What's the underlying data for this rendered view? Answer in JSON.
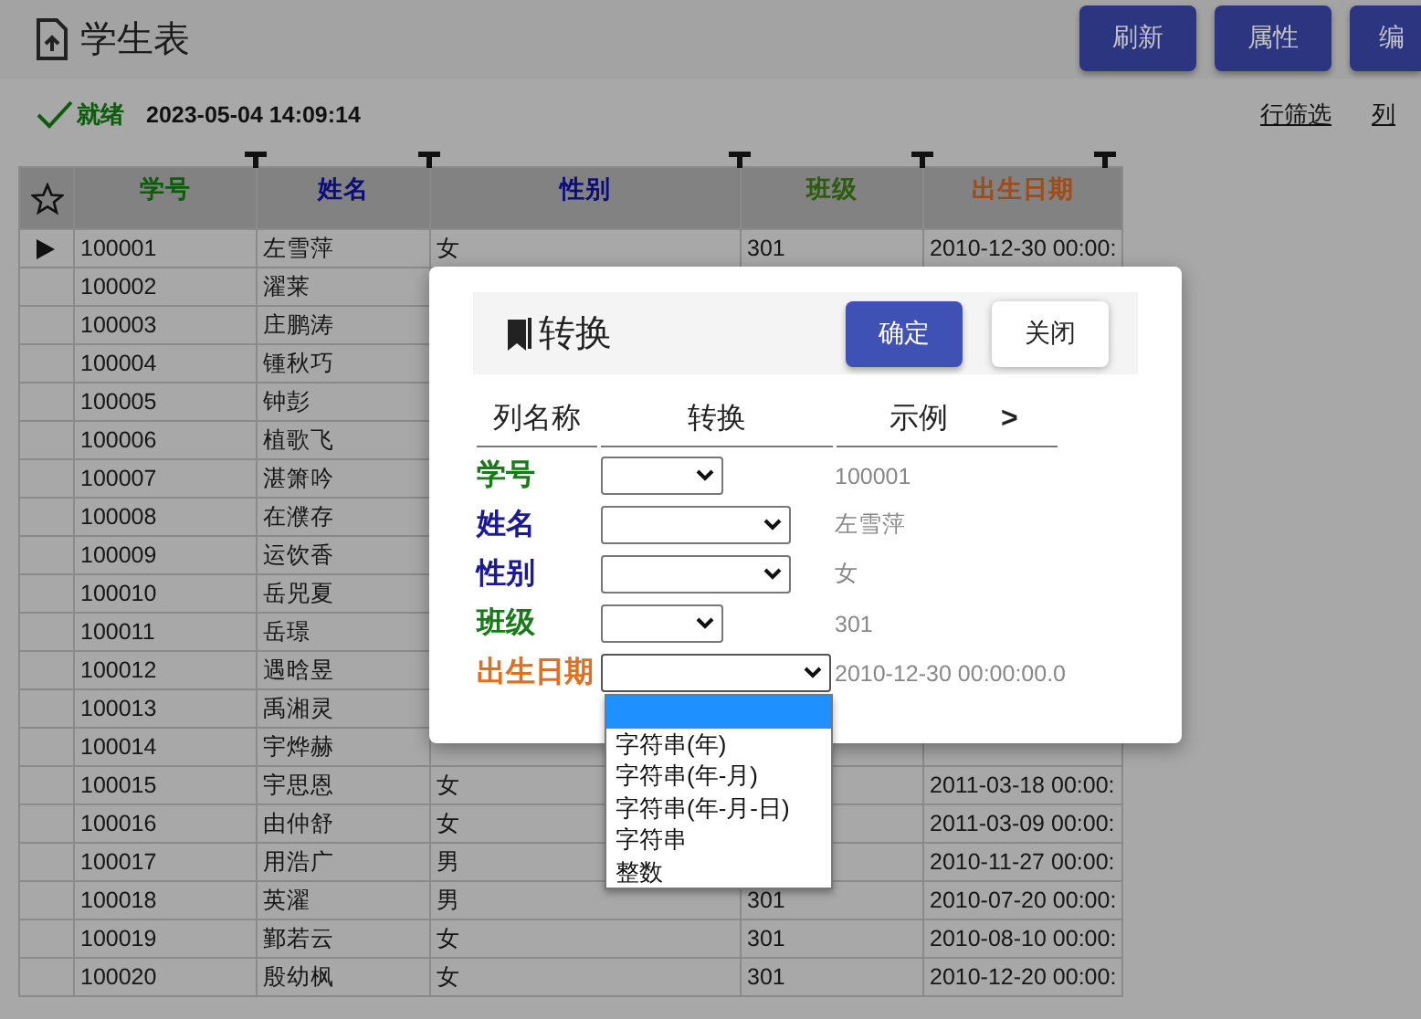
{
  "header": {
    "title": "学生表",
    "buttons": [
      "刷新",
      "属性",
      "编"
    ]
  },
  "status": {
    "label": "就绪",
    "time": "2023-05-04 14:09:14"
  },
  "links": [
    "行筛选",
    "列"
  ],
  "table": {
    "columns": [
      {
        "label": "学号",
        "color": "#0d5c0d"
      },
      {
        "label": "姓名",
        "color": "#0d0d7a"
      },
      {
        "label": "性别",
        "color": "#0d0d7a"
      },
      {
        "label": "班级",
        "color": "#2c5c0d"
      },
      {
        "label": "出生日期",
        "color": "#a04c1a"
      }
    ],
    "rows": [
      {
        "current": true,
        "cells": [
          "100001",
          "左雪萍",
          "女",
          "301",
          "2010-12-30 00:00:"
        ]
      },
      {
        "current": false,
        "cells": [
          "100002",
          "濯莱",
          null,
          null,
          null
        ]
      },
      {
        "current": false,
        "cells": [
          "100003",
          "庄鹏涛",
          null,
          null,
          null
        ]
      },
      {
        "current": false,
        "cells": [
          "100004",
          "锺秋巧",
          null,
          null,
          null
        ]
      },
      {
        "current": false,
        "cells": [
          "100005",
          "钟彭",
          null,
          null,
          null
        ]
      },
      {
        "current": false,
        "cells": [
          "100006",
          "植歌飞",
          null,
          null,
          null
        ]
      },
      {
        "current": false,
        "cells": [
          "100007",
          "湛箫吟",
          null,
          null,
          null
        ]
      },
      {
        "current": false,
        "cells": [
          "100008",
          "在濮存",
          null,
          null,
          null
        ]
      },
      {
        "current": false,
        "cells": [
          "100009",
          "运饮香",
          null,
          null,
          null
        ]
      },
      {
        "current": false,
        "cells": [
          "100010",
          "岳兕夏",
          null,
          null,
          null
        ]
      },
      {
        "current": false,
        "cells": [
          "100011",
          "岳璟",
          null,
          null,
          null
        ]
      },
      {
        "current": false,
        "cells": [
          "100012",
          "遇晗昱",
          null,
          null,
          null
        ]
      },
      {
        "current": false,
        "cells": [
          "100013",
          "禹湘灵",
          null,
          null,
          null
        ]
      },
      {
        "current": false,
        "cells": [
          "100014",
          "宇烨赫",
          null,
          null,
          null
        ]
      },
      {
        "current": false,
        "cells": [
          "100015",
          "宇思恩",
          "女",
          null,
          "2011-03-18 00:00:"
        ]
      },
      {
        "current": false,
        "cells": [
          "100016",
          "由仲舒",
          "女",
          null,
          "2011-03-09 00:00:"
        ]
      },
      {
        "current": false,
        "cells": [
          "100017",
          "用浩广",
          "男",
          null,
          "2010-11-27 00:00:"
        ]
      },
      {
        "current": false,
        "cells": [
          "100018",
          "英濯",
          "男",
          "301",
          "2010-07-20 00:00:"
        ]
      },
      {
        "current": false,
        "cells": [
          "100019",
          "鄞若云",
          "女",
          "301",
          "2010-08-10 00:00:"
        ]
      },
      {
        "current": false,
        "cells": [
          "100020",
          "殷幼枫",
          "女",
          "301",
          "2010-12-20 00:00:"
        ]
      }
    ]
  },
  "dialog": {
    "title": "转换",
    "buttons": [
      {
        "label": "确定",
        "kind": "primary"
      },
      {
        "label": "关闭",
        "kind": "plain"
      }
    ],
    "columns": [
      "列名称",
      "转换",
      "示例"
    ],
    "more": ">",
    "rows": [
      {
        "label": "学号",
        "color": "#1a7a1a",
        "example": "100001",
        "expanded": false
      },
      {
        "label": "姓名",
        "color": "#1a1a99",
        "example": "左雪萍",
        "expanded": false
      },
      {
        "label": "性别",
        "color": "#1a1a99",
        "example": "女",
        "expanded": false
      },
      {
        "label": "班级",
        "color": "#1a7a1a",
        "example": "301",
        "expanded": false
      },
      {
        "label": "出生日期",
        "color": "#e07020",
        "example": "2010-12-30 00:00:00.0",
        "expanded": true,
        "options": [
          {
            "selected": true
          },
          {
            "label": "字符串(年)",
            "selected": false
          },
          {
            "label": "字符串(年-月)",
            "selected": false
          },
          {
            "label": "字符串(年-月-日)",
            "selected": false
          },
          {
            "label": "字符串",
            "selected": false
          },
          {
            "label": "整数",
            "selected": false
          }
        ]
      }
    ]
  }
}
